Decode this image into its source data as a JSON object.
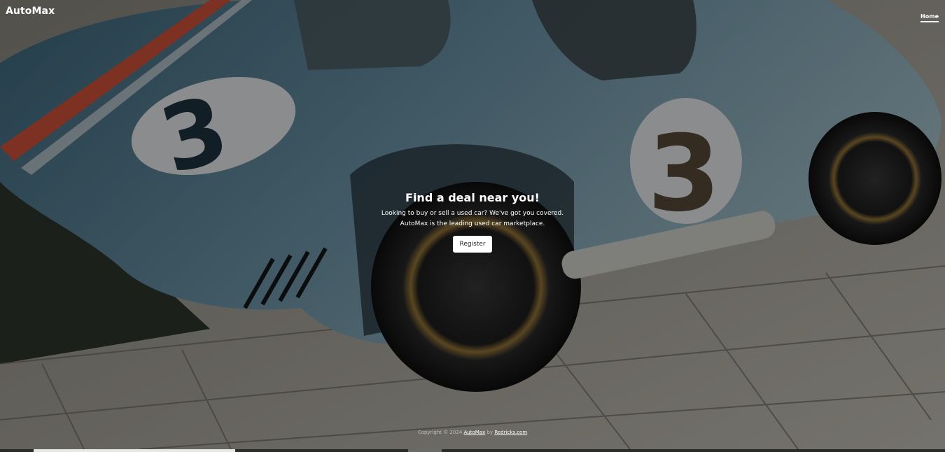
{
  "header": {
    "brand": "AutoMax",
    "nav": [
      {
        "label": "Home",
        "active": true
      }
    ]
  },
  "hero": {
    "title": "Find a deal near you!",
    "lead_line_1": "Looking to buy or sell a used car? We've got you covered.",
    "lead_line_2": "AutoMax is the leading used car marketplace.",
    "button_label": "Register",
    "background_subject": "race-car-photo"
  },
  "footer": {
    "prefix": "Copyright © 2024",
    "site_link": "AutoMax",
    "by": "by",
    "author_link": "Redricks.com"
  },
  "colors": {
    "overlay": "#000000",
    "car_body": "#5f8aa0",
    "stripe": "#d8553c",
    "pavement": "#a9a59c",
    "text": "#ffffff",
    "button_bg": "#ffffff"
  }
}
